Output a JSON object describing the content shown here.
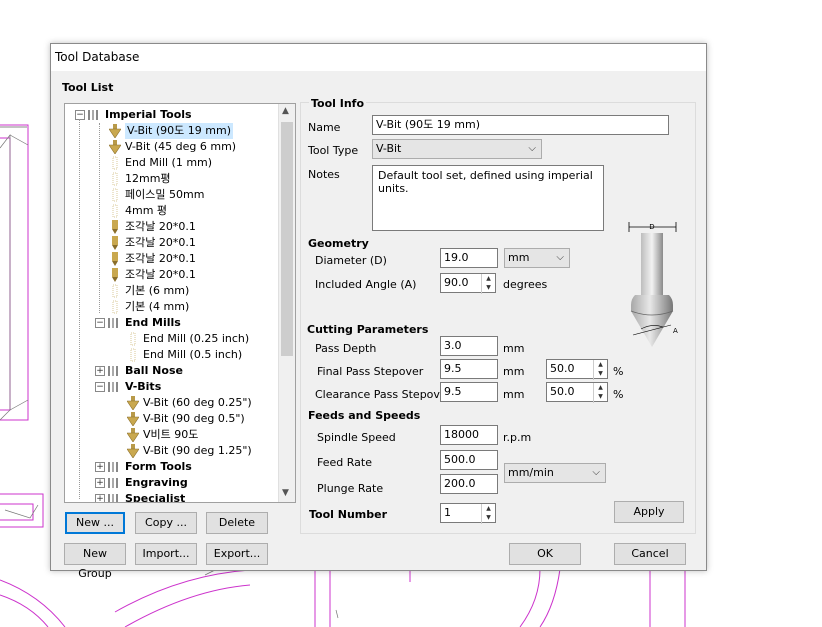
{
  "window": {
    "title": "Tool Database"
  },
  "tool_list": {
    "heading": "Tool List",
    "items": [
      {
        "label": "Imperial Tools",
        "level": 0,
        "type": "group",
        "expanded": true
      },
      {
        "label": "V-Bit (90도 19 mm)",
        "level": 1,
        "type": "vbit",
        "selected": true
      },
      {
        "label": "V-Bit (45 deg 6 mm)",
        "level": 1,
        "type": "vbit"
      },
      {
        "label": "End Mill (1 mm)",
        "level": 1,
        "type": "endmill"
      },
      {
        "label": "12mm평",
        "level": 1,
        "type": "endmill"
      },
      {
        "label": "페이스밀 50mm",
        "level": 1,
        "type": "endmill"
      },
      {
        "label": "4mm 평",
        "level": 1,
        "type": "endmill"
      },
      {
        "label": "조각날 20*0.1",
        "level": 1,
        "type": "engrave"
      },
      {
        "label": "조각날 20*0.1",
        "level": 1,
        "type": "engrave"
      },
      {
        "label": "조각날 20*0.1",
        "level": 1,
        "type": "engrave"
      },
      {
        "label": "조각날 20*0.1",
        "level": 1,
        "type": "engrave"
      },
      {
        "label": "기본 (6 mm)",
        "level": 1,
        "type": "endmill"
      },
      {
        "label": "기본 (4 mm)",
        "level": 1,
        "type": "endmill"
      },
      {
        "label": "End Mills",
        "level": 1,
        "type": "group",
        "expanded": true
      },
      {
        "label": "End Mill (0.25 inch)",
        "level": 2,
        "type": "endmill"
      },
      {
        "label": "End Mill (0.5 inch)",
        "level": 2,
        "type": "endmill"
      },
      {
        "label": "Ball Nose",
        "level": 1,
        "type": "group",
        "expanded": false
      },
      {
        "label": "V-Bits",
        "level": 1,
        "type": "group",
        "expanded": true
      },
      {
        "label": "V-Bit (60 deg 0.25\")",
        "level": 2,
        "type": "vbit"
      },
      {
        "label": "V-Bit (90 deg 0.5\")",
        "level": 2,
        "type": "vbit"
      },
      {
        "label": "V비트 90도",
        "level": 2,
        "type": "vbit"
      },
      {
        "label": "V-Bit (90 deg 1.25\")",
        "level": 2,
        "type": "vbit"
      },
      {
        "label": "Form Tools",
        "level": 1,
        "type": "group",
        "expanded": false
      },
      {
        "label": "Engraving",
        "level": 1,
        "type": "group",
        "expanded": false
      },
      {
        "label": "Specialist",
        "level": 1,
        "type": "group",
        "expanded": false
      }
    ],
    "buttons": {
      "new": "New ...",
      "copy": "Copy ...",
      "delete": "Delete",
      "new_group": "New Group",
      "import": "Import...",
      "export": "Export..."
    }
  },
  "tool_info": {
    "heading": "Tool Info",
    "name_label": "Name",
    "name_value": "V-Bit (90도 19 mm)",
    "type_label": "Tool Type",
    "type_value": "V-Bit",
    "notes_label": "Notes",
    "notes_value": "Default tool set, defined using imperial units."
  },
  "geometry": {
    "heading": "Geometry",
    "diameter_label": "Diameter (D)",
    "diameter_value": "19.0",
    "diameter_unit": "mm",
    "angle_label": "Included Angle (A)",
    "angle_value": "90.0",
    "angle_unit": "degrees",
    "diagram_d": "D",
    "diagram_a": "A"
  },
  "cutting": {
    "heading": "Cutting Parameters",
    "pass_depth_label": "Pass Depth",
    "pass_depth_value": "3.0",
    "pass_depth_unit": "mm",
    "final_label": "Final Pass Stepover",
    "final_value": "9.5",
    "final_unit": "mm",
    "final_pct": "50.0",
    "clearance_label": "Clearance Pass Stepover",
    "clearance_value": "9.5",
    "clearance_unit": "mm",
    "clearance_pct": "50.0",
    "pct_sign": "%"
  },
  "feeds": {
    "heading": "Feeds and Speeds",
    "spindle_label": "Spindle Speed",
    "spindle_value": "18000",
    "spindle_unit": "r.p.m",
    "feed_label": "Feed Rate",
    "feed_value": "500.0",
    "plunge_label": "Plunge Rate",
    "plunge_value": "200.0",
    "rate_unit": "mm/min"
  },
  "tool_number": {
    "label": "Tool Number",
    "value": "1"
  },
  "actions": {
    "apply": "Apply",
    "ok": "OK",
    "cancel": "Cancel"
  },
  "colors": {
    "toolpath": "#cc33cc",
    "focus": "#0078d7"
  }
}
